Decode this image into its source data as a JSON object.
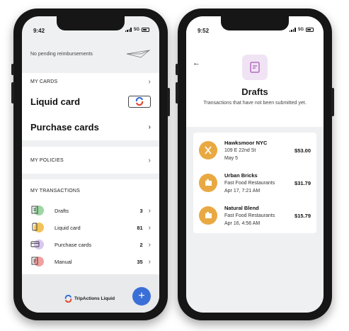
{
  "left": {
    "status": {
      "time": "9:42",
      "network": "5G"
    },
    "reimbursements_text": "No pending reimbursements",
    "cards_section": {
      "header": "MY CARDS",
      "liquid_card": "Liquid card",
      "purchase_cards": "Purchase cards"
    },
    "policies_header": "MY POLICIES",
    "transactions": {
      "header": "MY TRANSACTIONS",
      "items": [
        {
          "label": "Drafts",
          "count": "3",
          "color": "#9bd6a3"
        },
        {
          "label": "Liquid card",
          "count": "81",
          "color": "#f2c35a"
        },
        {
          "label": "Purchase cards",
          "count": "2",
          "color": "#d8c8ef"
        },
        {
          "label": "Manual",
          "count": "35",
          "color": "#f1a0a0"
        }
      ]
    },
    "brand": "TripActions Liquid",
    "fab_label": "+"
  },
  "right": {
    "status": {
      "time": "9:52",
      "network": "5G"
    },
    "back_glyph": "←",
    "title": "Drafts",
    "subtitle": "Transactions that have not been submitted yet.",
    "items": [
      {
        "name": "Hawksmoor NYC",
        "line2": "109 E 22nd St",
        "line3": "May 5",
        "amount": "$53.00",
        "icon": "utensils-icon"
      },
      {
        "name": "Urban Bricks",
        "line2": "Fast Food Restaurants",
        "line3": "Apr 17, 7:21 AM",
        "amount": "$31.79",
        "icon": "receipt-icon"
      },
      {
        "name": "Natural Blend",
        "line2": "Fast Food Restaurants",
        "line3": "Apr 16, 4:56 AM",
        "amount": "$15.79",
        "icon": "receipt-icon"
      }
    ],
    "accent": "#e9a942"
  }
}
